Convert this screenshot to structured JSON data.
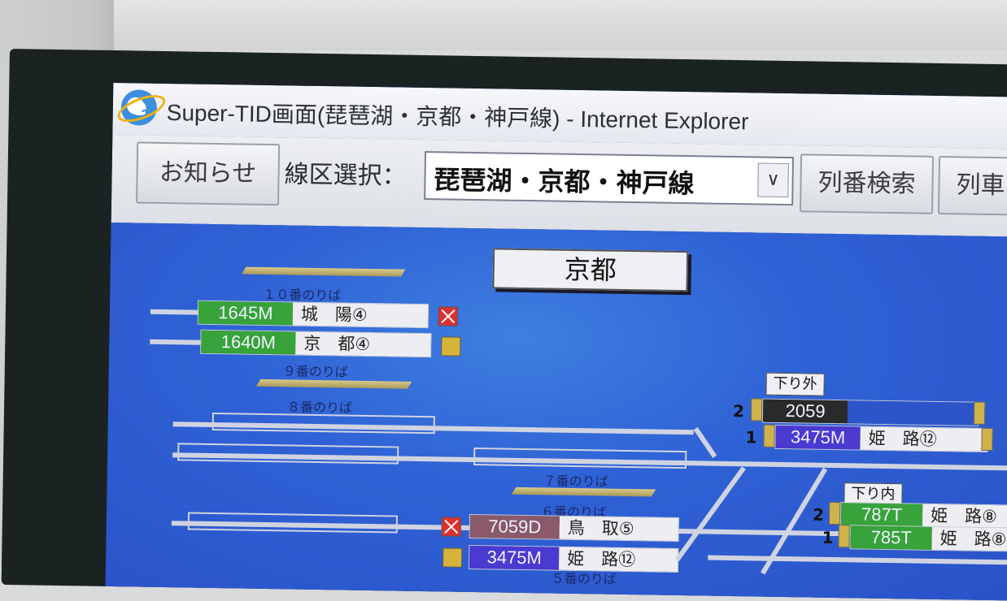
{
  "window": {
    "title": "Super-TID画面(琵琶湖・京都・神戸線) - Internet Explorer"
  },
  "toolbar": {
    "notice_label": "お知らせ",
    "route_label": "線区選択：",
    "route_value": "琵琶湖・京都・神戸線",
    "search_label": "列番検索",
    "list_label": "列車"
  },
  "diagram": {
    "station": "京都",
    "platforms": {
      "p10": "１０番のりば",
      "p9": "９番のりば",
      "p8": "８番のりば",
      "p7": "７番のりば",
      "p6": "６番のりば",
      "p5": "５番のりば"
    },
    "trains_left": [
      {
        "number": "1645M",
        "dest": "城　陽④",
        "color": "#37a33a"
      },
      {
        "number": "1640M",
        "dest": "京　都④",
        "color": "#37a33a"
      },
      {
        "number": "7059D",
        "dest": "鳥　取⑤",
        "color": "#8a5a6a"
      },
      {
        "number": "3475M",
        "dest": "姫　路⑫",
        "color": "#4a3ad0"
      }
    ],
    "down_outer": {
      "label": "下り外",
      "rows": [
        {
          "track": "2",
          "number": "2059",
          "dest": "",
          "color": "#2a2a2a"
        },
        {
          "track": "1",
          "number": "3475M",
          "dest": "姫　路⑫",
          "color": "#4a3ad0"
        }
      ]
    },
    "down_inner": {
      "label": "下り内",
      "rows": [
        {
          "track": "2",
          "number": "787T",
          "dest": "姫　路⑧",
          "color": "#37a33a"
        },
        {
          "track": "1",
          "number": "785T",
          "dest": "姫　路⑧",
          "color": "#37a33a"
        }
      ]
    }
  }
}
